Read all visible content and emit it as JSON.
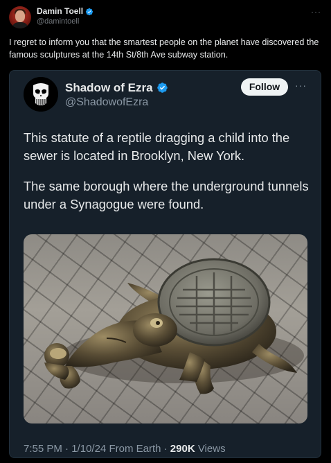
{
  "outer_post": {
    "author_name": "Damin Toell",
    "author_handle": "@damintoell",
    "more_label": "···",
    "text": "I regret to inform you that the smartest people on the planet have discovered the famous sculptures at the 14th St/8th Ave subway station."
  },
  "quoted_post": {
    "author_name": "Shadow of Ezra",
    "author_handle": "@ShadowofEzra",
    "follow_label": "Follow",
    "more_label": "···",
    "paragraph_1": "This statute of a reptile dragging a child into the sewer is located in Brooklyn, New York.",
    "paragraph_2": "The same borough where the underground tunnels under a Synagogue were found.",
    "time": "7:55 PM",
    "date": "1/10/24",
    "source": "From Earth",
    "views_count": "290K",
    "views_label": "Views",
    "separator": "·"
  },
  "colors": {
    "background": "#000000",
    "card_background": "#16202a",
    "verified": "#1d9bf0",
    "primary_text": "#e7e9ea",
    "secondary_text": "#8b98a5"
  },
  "icons": [
    "verified-badge-icon",
    "more-options-icon",
    "punisher-skull-avatar"
  ]
}
